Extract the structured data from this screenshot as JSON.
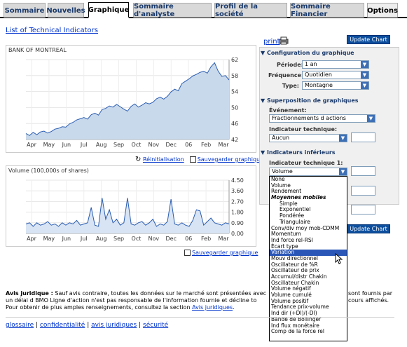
{
  "tabs": [
    "Sommaire",
    "Nouvelles",
    "Graphique",
    "Sommaire d'analyste",
    "Profil de la société",
    "Sommaire Financier",
    "Options"
  ],
  "top_link": "List of Technical Indicators",
  "print_label": "print",
  "update_chart": "Update Chart",
  "main_chart": {
    "title": "BANK OF MONTREAL",
    "x_labels": [
      "Apr",
      "May",
      "Jun",
      "Jul",
      "Aug",
      "Sep",
      "Oct",
      "Nov",
      "Dec",
      "06",
      "Feb",
      "Mar"
    ],
    "y_labels": [
      "62",
      "58",
      "54",
      "50",
      "46",
      "42"
    ],
    "ylim": [
      42,
      62
    ],
    "values": [
      43.5,
      43,
      43.8,
      43.2,
      43.9,
      44.1,
      43.6,
      44,
      44.6,
      44.8,
      45.2,
      45.1,
      45.9,
      46.3,
      46.9,
      47.2,
      47.5,
      47.1,
      48.2,
      48.6,
      48.1,
      49.5,
      49.8,
      50.4,
      50.1,
      50.8,
      50.2,
      49.6,
      49.1,
      50.3,
      50.9,
      50.1,
      50.6,
      51.2,
      50.9,
      51.3,
      52.2,
      52.6,
      52.1,
      52.8,
      53.9,
      54.6,
      54.2,
      56,
      56.6,
      57.2,
      57.9,
      58.3,
      58.8,
      59.1,
      58.6,
      60.2,
      61.2,
      59.1,
      57.8,
      58,
      56.9
    ]
  },
  "main_tools": {
    "reset": "Réinitialisation",
    "save": "Sauvegarder graphique"
  },
  "volume_chart": {
    "title": "Volume (100,000s of shares)",
    "x_labels": [
      "Apr",
      "May",
      "Jun",
      "Jul",
      "Aug",
      "Sep",
      "Oct",
      "Nov",
      "Dec",
      "06",
      "Feb",
      "Mar"
    ],
    "y_labels": [
      "4.50",
      "3.60",
      "2.70",
      "1.80",
      "0.90",
      "0.00"
    ],
    "ylim": [
      0,
      4.5
    ],
    "values": [
      0.8,
      0.9,
      0.6,
      0.9,
      0.7,
      0.8,
      1,
      0.7,
      0.8,
      0.6,
      0.9,
      0.7,
      0.9,
      0.8,
      1.1,
      0.7,
      0.8,
      0.9,
      2.2,
      0.7,
      0.6,
      3,
      1.2,
      2,
      0.9,
      1.2,
      0.7,
      0.9,
      3,
      0.8,
      0.7,
      0.9,
      1,
      0.7,
      0.9,
      1.2,
      0.6,
      0.8,
      0.7,
      1,
      2.9,
      0.8,
      0.7,
      0.9,
      0.7,
      0.6,
      1.1,
      2,
      1.9,
      0.7,
      1,
      1.3,
      0.9,
      0.8,
      0.7,
      0.9,
      0.8
    ]
  },
  "volume_tools": {
    "save": "Sauvegarder graphique"
  },
  "config": {
    "header": "Configuration du graphique",
    "periode_label": "Période:",
    "periode_value": "1 an",
    "frequence_label": "Fréquence:",
    "frequence_value": "Quotidien",
    "type_label": "Type:",
    "type_value": "Montagne"
  },
  "overlay": {
    "header": "Superposition de graphiques",
    "event_label": "Événement:",
    "event_value": "Fractionnements d actions",
    "tech_label": "Indicateur technique:",
    "tech_value": "Aucun"
  },
  "lower": {
    "header": "Indicateurs inférieurs",
    "tech_label": "Indicateur technique 1:",
    "tech_value": "Volume"
  },
  "dropdown_items": [
    {
      "label": "None",
      "style": ""
    },
    {
      "label": "Volume",
      "style": ""
    },
    {
      "label": "Rendement",
      "style": ""
    },
    {
      "label": "Moyennes mobiles",
      "style": "ital"
    },
    {
      "label": "Simple",
      "style": "ind"
    },
    {
      "label": "Exponentiel",
      "style": "ind"
    },
    {
      "label": "Pondérée",
      "style": "ind"
    },
    {
      "label": "Triangulaire",
      "style": "ind"
    },
    {
      "label": "Conv/div moy mob-CDMM",
      "style": ""
    },
    {
      "label": "Momentum",
      "style": ""
    },
    {
      "label": "Ind force rel-RSI",
      "style": ""
    },
    {
      "label": "Écart type",
      "style": ""
    },
    {
      "label": "Variation",
      "style": "hl"
    },
    {
      "label": "Mouv directionnel",
      "style": ""
    },
    {
      "label": "Oscillateur de %R",
      "style": ""
    },
    {
      "label": "Oscillateur de prix",
      "style": ""
    },
    {
      "label": "Accumul/distr Chakin",
      "style": ""
    },
    {
      "label": "Oscillateur Chakin",
      "style": ""
    },
    {
      "label": "Volume négatif",
      "style": ""
    },
    {
      "label": "Volume cumulé",
      "style": ""
    },
    {
      "label": "Volume positif",
      "style": ""
    },
    {
      "label": "Tendance prix-volume",
      "style": ""
    },
    {
      "label": "Ind dir (+DI)/(-DI)",
      "style": ""
    },
    {
      "label": "Bande de Bollinger",
      "style": ""
    },
    {
      "label": "Ind flux monétaire",
      "style": ""
    },
    {
      "label": "Comp de la force rel",
      "style": ""
    }
  ],
  "legal": {
    "title": "Avis juridique :",
    "text": "Sauf avis contraire, toutes les données sur le marché sont présentées avec un délai d BMO Ligne d'action n'est pas responsable de l'information fournie et décline to",
    "more": "Pour obtenir de plus amples renseignements, consultez la section",
    "link": "Avis juridiques",
    "right1": "sont fournis par",
    "right2": "cours affichés."
  },
  "footer": [
    "glossaire",
    "confidentialité",
    "avis juridiques",
    "sécurité"
  ]
}
